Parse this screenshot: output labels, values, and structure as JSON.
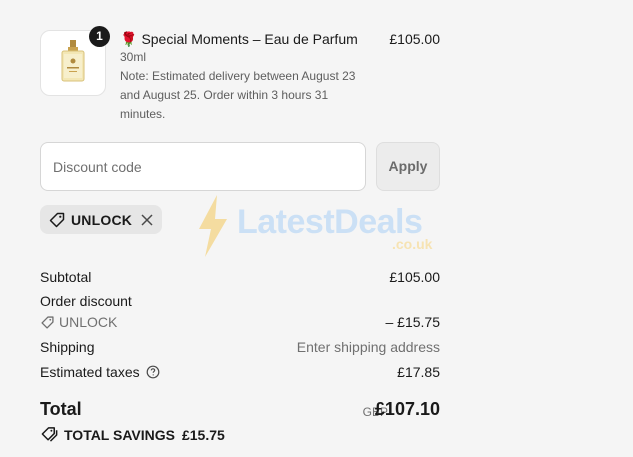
{
  "product": {
    "quantity": "1",
    "emoji": "🌹",
    "name": "Special Moments – Eau de Parfum",
    "price": "£105.00",
    "variant": "30ml",
    "note": "Note: Estimated delivery between August 23 and August 25. Order within 3 hours 31 minutes."
  },
  "discount": {
    "placeholder": "Discount code",
    "apply_label": "Apply",
    "applied_code": "UNLOCK"
  },
  "watermark": {
    "text": "LatestDeals",
    "sub": ".co.uk"
  },
  "summary": {
    "subtotal_label": "Subtotal",
    "subtotal_value": "£105.00",
    "order_discount_label": "Order discount",
    "discount_code": "UNLOCK",
    "discount_value": "– £15.75",
    "shipping_label": "Shipping",
    "shipping_value": "Enter shipping address",
    "taxes_label": "Estimated taxes",
    "taxes_value": "£17.85",
    "total_label": "Total",
    "currency": "GBP",
    "total_value": "£107.10",
    "savings_label": "TOTAL SAVINGS",
    "savings_value": "£15.75"
  },
  "icons": {
    "product_image": "perfume-bottle-icon",
    "tag": "tag-icon",
    "remove": "close-icon",
    "help": "question-circle-icon",
    "savings": "tags-icon"
  }
}
